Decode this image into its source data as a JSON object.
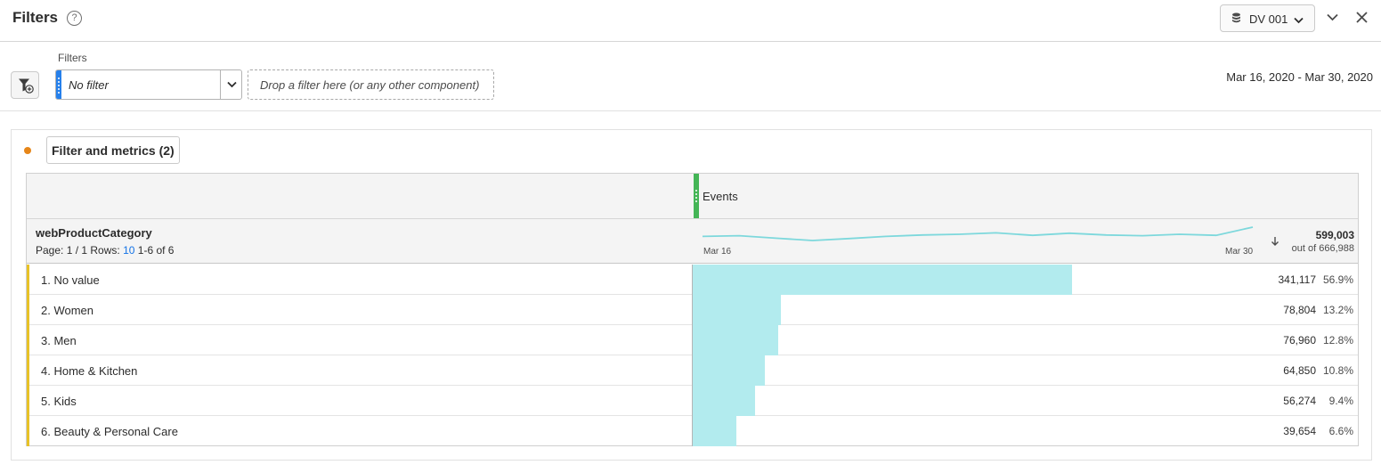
{
  "header": {
    "title": "Filters",
    "help_glyph": "?",
    "dataview_label": "DV 001",
    "icons": [
      "help-icon",
      "database-icon",
      "chevron-down-icon",
      "collapse-icon",
      "close-icon"
    ]
  },
  "filterbar": {
    "filters_label": "Filters",
    "filter_value": "No filter",
    "drop_zone_text": "Drop a filter here (or any other component)",
    "date_range": "Mar 16, 2020 - Mar 30, 2020"
  },
  "panel": {
    "title": "Filter and metrics (2)",
    "status_color": "#e68619"
  },
  "table": {
    "metric_name": "Events",
    "metric_color": "#44b556",
    "dimension": "webProductCategory",
    "page_label": "Page: 1 / 1",
    "rows_label": "Rows:",
    "rows_value": "10",
    "range_label": "1-6 of 6",
    "spark_start": "Mar 16",
    "spark_end": "Mar 30",
    "trend": [
      0.62,
      0.58,
      0.72,
      0.85,
      0.74,
      0.62,
      0.54,
      0.5,
      0.42,
      0.56,
      0.44,
      0.54,
      0.58,
      0.5,
      0.56,
      0.1
    ],
    "total": "599,003",
    "total_sub": "out of 666,988",
    "bar_color": "#b2ebee",
    "accent_color": "#e8c227",
    "rows": [
      {
        "label": "1. No value",
        "value": "341,117",
        "pct": "56.9%",
        "share": 0.569
      },
      {
        "label": "2. Women",
        "value": "78,804",
        "pct": "13.2%",
        "share": 0.132
      },
      {
        "label": "3. Men",
        "value": "76,960",
        "pct": "12.8%",
        "share": 0.128
      },
      {
        "label": "4. Home & Kitchen",
        "value": "64,850",
        "pct": "10.8%",
        "share": 0.108
      },
      {
        "label": "5. Kids",
        "value": "56,274",
        "pct": "9.4%",
        "share": 0.094
      },
      {
        "label": "6. Beauty & Personal Care",
        "value": "39,654",
        "pct": "6.6%",
        "share": 0.066
      }
    ]
  }
}
